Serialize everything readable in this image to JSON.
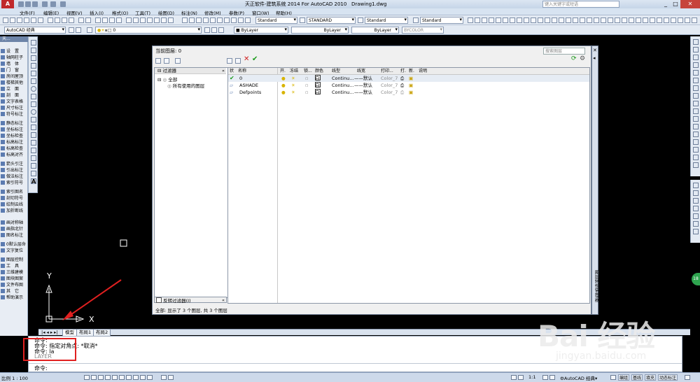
{
  "app": {
    "title": "天正软件-建筑系统 2014  For AutoCAD 2010",
    "filename": "Drawing1.dwg",
    "logo_letter": "A",
    "search_placeholder": "键入关键字或短语"
  },
  "menubar": [
    "文件(F)",
    "编辑(E)",
    "视图(V)",
    "插入(I)",
    "格式(O)",
    "工具(T)",
    "绘图(D)",
    "标注(N)",
    "修改(M)",
    "参数(P)",
    "窗口(W)",
    "帮助(H)"
  ],
  "toolbar1": {
    "text_style": "Standard",
    "dim_style": "STANDARD",
    "table_style": "Standard",
    "mleader_style": "Standard"
  },
  "toolbar2": {
    "workspace": "AutoCAD 经典",
    "layer": "0",
    "color": "ByLayer",
    "linetype": "ByLayer",
    "lineweight": "ByLayer",
    "plotstyle": "BYCOLOR"
  },
  "left_palette": {
    "header": "天...",
    "items": [
      "设　置",
      "轴网柱子",
      "墙　体",
      "门　窗",
      "房间屋顶",
      "楼梯其他",
      "立　面",
      "剖　面",
      "文字表格",
      "尺寸标注",
      "符号标注",
      "静态标注",
      "坐标标注",
      "坐标检查",
      "标高标注",
      "标高检查",
      "标高对齐",
      "箭头引注",
      "引出标注",
      "做法标注",
      "索引符号",
      "索引图名",
      "剖切符号",
      "绘制云线",
      "加折断线",
      "画对称轴",
      "画指北针",
      "图名标注",
      "0默认层命",
      "文字复位",
      "图层控制",
      "工　具",
      "三维建模",
      "图块图案",
      "文件布图",
      "其　它",
      "帮助演示"
    ]
  },
  "layer_dialog": {
    "title": "当前图层: 0",
    "search_placeholder": "搜索图层",
    "filter_header": "过滤器",
    "tree": [
      "全部",
      "所有使用的图层"
    ],
    "invert_filter": "反转过滤器(I)",
    "columns": [
      "状",
      "名称",
      "开.",
      "冻结",
      "锁...",
      "颜色",
      "线型",
      "线宽",
      "打印...",
      "打.",
      "新.",
      "说明"
    ],
    "rows": [
      {
        "name": "0",
        "color": "白",
        "linetype": "Continu...",
        "lineweight": "默认",
        "plotstyle": "Color_7",
        "current": true
      },
      {
        "name": "ASHADE",
        "color": "白",
        "linetype": "Continu...",
        "lineweight": "默认",
        "plotstyle": "Color_7",
        "current": false
      },
      {
        "name": "Defpoints",
        "color": "白",
        "linetype": "Continu...",
        "lineweight": "默认",
        "plotstyle": "Color_7",
        "current": false
      }
    ],
    "status": "全部: 显示了 3 个图层, 共 3 个图层",
    "side_label": "图层特性管理器"
  },
  "tabs": [
    "模型",
    "布局1",
    "布局2"
  ],
  "command": {
    "lines": [
      "命令:",
      "命令: 指定对角点: *取消*",
      "命令: la",
      "LAYER"
    ],
    "prompt": "命令:"
  },
  "status_bar": {
    "scale": "比例 1 : 100",
    "anno_scale": "1:1",
    "workspace": "AutoCAD 经典",
    "buttons": [
      "编组",
      "基线",
      "填充",
      "动态标注"
    ]
  },
  "watermark": {
    "big": "Bai 经验",
    "small": "jingyan.baidu.com"
  },
  "canvas_axis": {
    "y": "Y",
    "x": "X"
  },
  "side_badge": "18"
}
